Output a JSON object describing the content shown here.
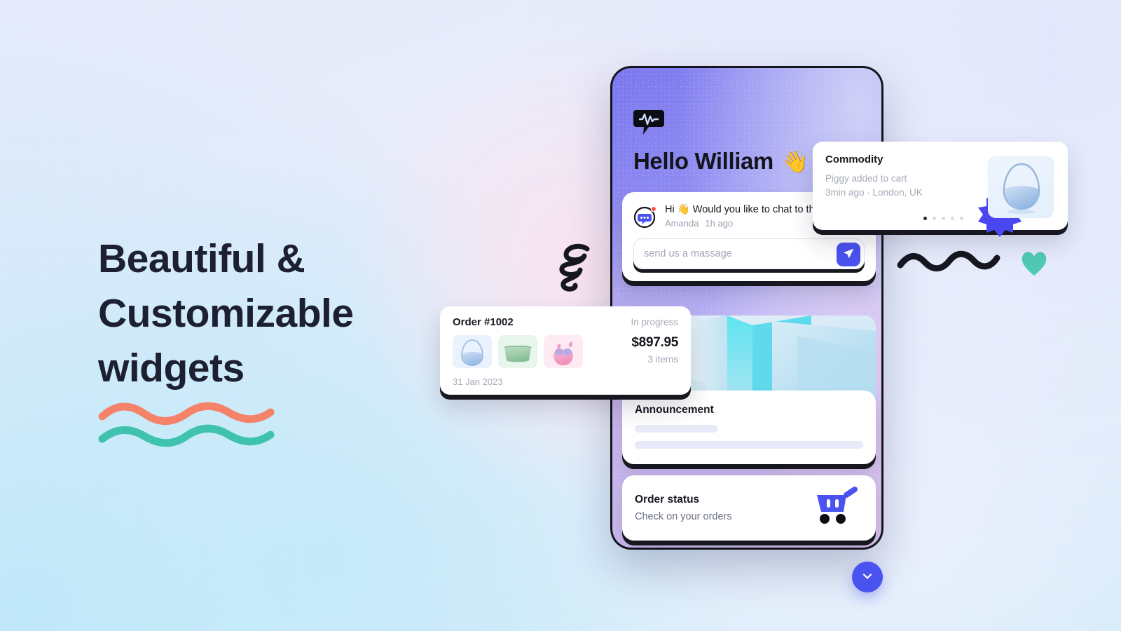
{
  "hero": {
    "headline_line1": "Beautiful &",
    "headline_line2": "Customizable",
    "headline_line3": "widgets",
    "underline_colors": [
      "#f5836a",
      "#3fc2ae"
    ]
  },
  "colors": {
    "accent_blue": "#4a53ef",
    "ink": "#16171f",
    "muted": "#a6aab9",
    "teal": "#3fc2ae",
    "coral": "#f5836a",
    "skeleton": "#e9eaf9"
  },
  "phone": {
    "logo_icon": "chat-pulse-logo-icon",
    "greeting": "Hello William",
    "greeting_emoji": "👋",
    "chat": {
      "avatar_icon": "chat-bubble-avatar-icon",
      "badge_icon": "unread-dot-icon",
      "message": "Hi 👋 Would you like to chat to the",
      "sender": "Amanda",
      "time": "1h ago",
      "input_value": "",
      "input_placeholder": "send us a massage",
      "send_icon": "send-paper-plane-icon"
    },
    "announcement": {
      "title": "Announcement"
    },
    "order_status": {
      "title": "Order status",
      "subtitle": "Check on your orders",
      "icon": "shopping-cart-icon"
    }
  },
  "commodity_card": {
    "title": "Commodity",
    "subtitle": "Piggy added to cart",
    "meta": "3min ago · London, UK",
    "dots_total": 5,
    "dots_active_index": 0,
    "product_icon": "handbag-product-icon",
    "burst_icon": "starburst-badge-icon"
  },
  "order_card": {
    "order_id": "Order #1002",
    "status": "In progress",
    "amount": "$897.95",
    "items": "3 items",
    "date": "31 Jan 2023",
    "thumbnails": [
      {
        "name": "blue-hobo-bag-thumbnail",
        "bg": "#eaf2fd"
      },
      {
        "name": "green-belt-bag-thumbnail",
        "bg": "#e8f5ec"
      },
      {
        "name": "pink-earbuds-thumbnail",
        "bg": "#fdeaf2"
      }
    ]
  },
  "decorations": {
    "spiral": "spiral-doodle-icon",
    "squiggle": "wave-squiggle-icon",
    "heart": "heart-icon"
  },
  "fab": {
    "icon": "chevron-down-icon"
  }
}
